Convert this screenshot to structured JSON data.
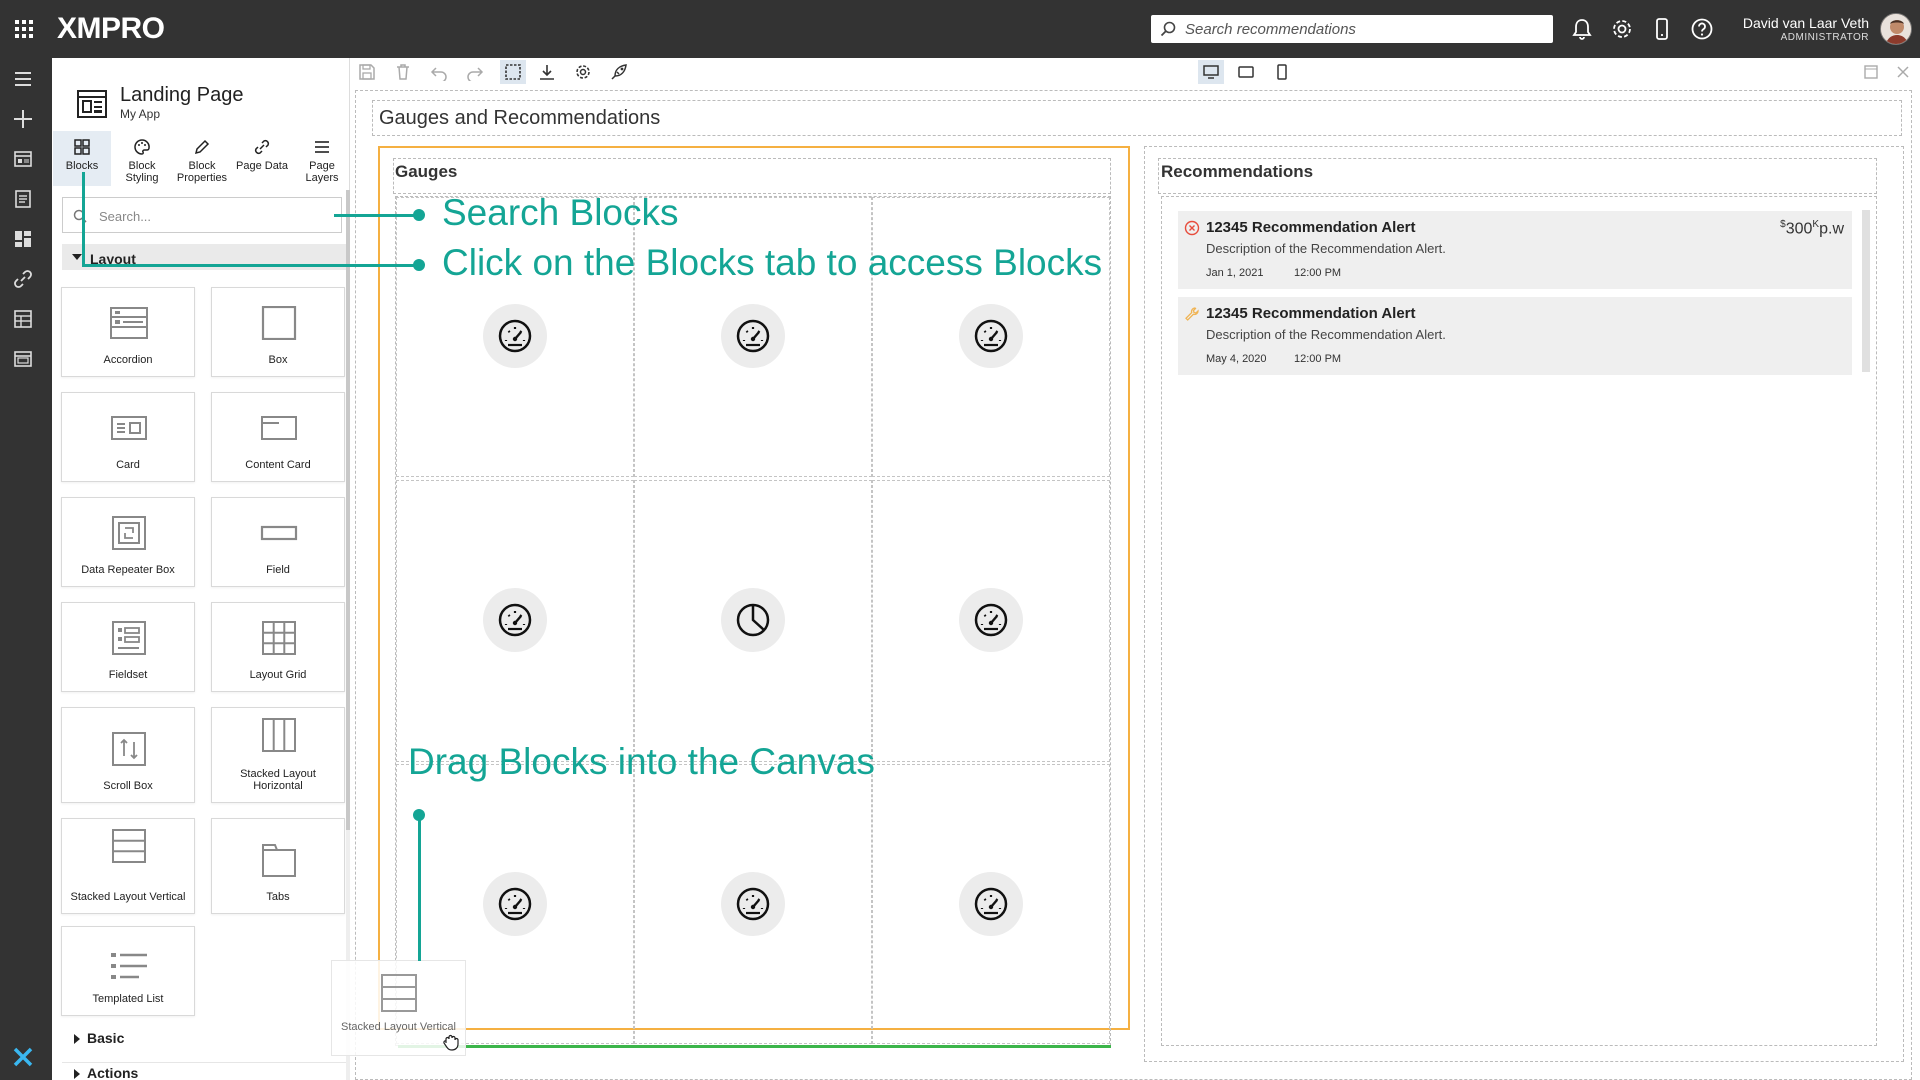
{
  "app": {
    "logo": "XMPRO"
  },
  "topbar": {
    "search_placeholder": "Search recommendations",
    "user_name": "David van Laar Veth",
    "user_role": "ADMINISTRATOR"
  },
  "page": {
    "title": "Landing Page",
    "subtitle": "My App"
  },
  "tabs": [
    {
      "label": "Blocks",
      "icon": "blocks-icon",
      "active": true
    },
    {
      "label": "Block Styling",
      "icon": "palette-icon"
    },
    {
      "label": "Block Properties",
      "icon": "pencil-icon"
    },
    {
      "label": "Page Data",
      "icon": "link-icon"
    },
    {
      "label": "Page Layers",
      "icon": "layers-icon"
    }
  ],
  "panel_search": {
    "placeholder": "Search..."
  },
  "sections": {
    "layout": "Layout",
    "basic": "Basic",
    "actions": "Actions"
  },
  "blocks": [
    {
      "label": "Accordion",
      "icon": "accordion-icon"
    },
    {
      "label": "Box",
      "icon": "box-icon"
    },
    {
      "label": "Card",
      "icon": "card-icon"
    },
    {
      "label": "Content Card",
      "icon": "content-card-icon"
    },
    {
      "label": "Data Repeater Box",
      "icon": "data-repeater-icon"
    },
    {
      "label": "Field",
      "icon": "field-icon"
    },
    {
      "label": "Fieldset",
      "icon": "fieldset-icon"
    },
    {
      "label": "Layout Grid",
      "icon": "layout-grid-icon"
    },
    {
      "label": "Scroll Box",
      "icon": "scroll-box-icon"
    },
    {
      "label": "Stacked Layout Horizontal",
      "icon": "stacked-horizontal-icon"
    },
    {
      "label": "Stacked Layout Vertical",
      "icon": "stacked-vertical-icon"
    },
    {
      "label": "Tabs",
      "icon": "tabs-icon"
    },
    {
      "label": "Templated List",
      "icon": "templated-list-icon"
    }
  ],
  "canvas": {
    "title": "Gauges and Recommendations",
    "gauges_title": "Gauges",
    "recommendations_title": "Recommendations",
    "drag_ghost_label": "Stacked Layout Vertical"
  },
  "recommendations": [
    {
      "title": "12345 Recommendation Alert",
      "description": "Description of the Recommendation Alert.",
      "date": "Jan 1, 2021",
      "time": "12:00 PM",
      "price_prefix": "$",
      "price_value": "300",
      "price_suffix_sup": "K",
      "price_unit": "p.w",
      "status_icon": "error-circle-icon",
      "status_color": "#e74c3c"
    },
    {
      "title": "12345 Recommendation Alert",
      "description": "Description of the Recommendation Alert.",
      "date": "May 4, 2020",
      "time": "12:00 PM",
      "status_icon": "wrench-icon",
      "status_color": "#f0b454"
    }
  ],
  "annotations": {
    "search_blocks": "Search Blocks",
    "blocks_tab": "Click on the Blocks tab to access Blocks",
    "drag_blocks": "Drag Blocks into the Canvas"
  },
  "colors": {
    "accent": "#14a595",
    "topbar": "#333333",
    "highlight": "#f5b041",
    "drop_indicator": "#3cb54a"
  }
}
